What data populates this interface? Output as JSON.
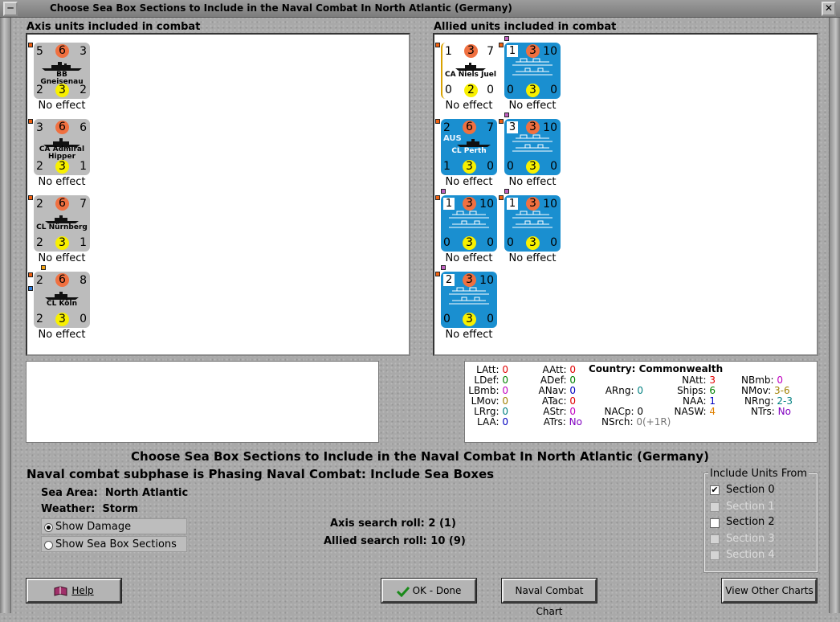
{
  "window": {
    "title": "Choose Sea Box Sections to Include in the Naval Combat In North Atlantic (Germany)"
  },
  "axis": {
    "header": "Axis units included in combat",
    "units": [
      {
        "tl": "5",
        "att": "6",
        "tr": "3",
        "name": "BB Gneisenau",
        "bl": "2",
        "def": "3",
        "br": "2",
        "effect": "No effect"
      },
      {
        "tl": "3",
        "att": "6",
        "tr": "6",
        "name": "CA Admiral Hipper",
        "bl": "2",
        "def": "3",
        "br": "1",
        "effect": "No effect"
      },
      {
        "tl": "2",
        "att": "6",
        "tr": "7",
        "name": "CL Nürnberg",
        "bl": "2",
        "def": "3",
        "br": "1",
        "effect": "No effect"
      },
      {
        "tl": "2",
        "att": "6",
        "tr": "8",
        "name": "CL Köln",
        "bl": "2",
        "def": "3",
        "br": "0",
        "effect": "No effect"
      }
    ]
  },
  "allied": {
    "header": "Allied units included in combat",
    "units": [
      {
        "tl": "1",
        "att": "3",
        "tr": "7",
        "name": "CA Niels Juel",
        "bl": "0",
        "def": "2",
        "br": "0",
        "effect": "No effect"
      },
      {
        "tl": "1",
        "att": "3",
        "tr": "10",
        "bl": "0",
        "def": "3",
        "br": "0",
        "effect": "No effect"
      },
      {
        "tl": "2",
        "att": "6",
        "tr": "7",
        "name": "CL Perth",
        "nation": "AUS",
        "bl": "1",
        "def": "3",
        "br": "0",
        "effect": "No effect"
      },
      {
        "tl": "3",
        "att": "3",
        "tr": "10",
        "bl": "0",
        "def": "3",
        "br": "0",
        "effect": "No effect"
      },
      {
        "tl": "1",
        "att": "3",
        "tr": "10",
        "bl": "0",
        "def": "3",
        "br": "0",
        "effect": "No effect"
      },
      {
        "tl": "1",
        "att": "3",
        "tr": "10",
        "bl": "0",
        "def": "3",
        "br": "0",
        "effect": "No effect"
      },
      {
        "tl": "2",
        "att": "3",
        "tr": "10",
        "bl": "0",
        "def": "3",
        "br": "0",
        "effect": "No effect"
      }
    ]
  },
  "stats": {
    "country_label": "Country:",
    "country": "Commonwealth",
    "latt": "0",
    "ldef": "0",
    "lbmb": "0",
    "lmov": "0",
    "lrrg": "0",
    "laa": "0",
    "aatt": "0",
    "adef": "0",
    "anav": "0",
    "atac": "0",
    "astr": "0",
    "atrs": "No",
    "arng": "0",
    "nacp": "0",
    "nsrch": "0(+1R)",
    "natt": "3",
    "ships": "6",
    "naa": "1",
    "nasw": "4",
    "nbmb": "0",
    "nmov": "3-6",
    "nrng": "2-3",
    "ntrs": "No",
    "colors": {
      "red": "#e00000",
      "green": "#008000",
      "magenta": "#c000c0",
      "olive": "#a08000",
      "teal": "#008080",
      "blue": "#0000c0",
      "purple": "#8000c0",
      "orange": "#e08000"
    }
  },
  "main": {
    "title": "Choose Sea Box Sections to Include in the Naval Combat In North Atlantic (Germany)",
    "subphase": "Naval combat subphase is Phasing Naval Combat: Include Sea Boxes",
    "sea_area_label": "Sea Area:",
    "sea_area": "North Atlantic",
    "weather_label": "Weather:",
    "weather": "Storm",
    "show_damage": "Show Damage",
    "show_sections": "Show Sea Box Sections",
    "axis_roll_label": "Axis search roll:",
    "axis_roll": "2 (1)",
    "allied_roll_label": "Allied search roll:",
    "allied_roll": "10 (9)"
  },
  "include": {
    "header": "Include Units From",
    "sections": [
      {
        "label": "Section 0",
        "checked": true,
        "enabled": true
      },
      {
        "label": "Section 1",
        "checked": false,
        "enabled": false
      },
      {
        "label": "Section 2",
        "checked": false,
        "enabled": true
      },
      {
        "label": "Section 3",
        "checked": false,
        "enabled": false
      },
      {
        "label": "Section 4",
        "checked": false,
        "enabled": false
      }
    ]
  },
  "buttons": {
    "help": "Help",
    "ok": "OK - Done",
    "naval_chart": "Naval Combat Chart",
    "other_charts": "View Other Charts"
  }
}
